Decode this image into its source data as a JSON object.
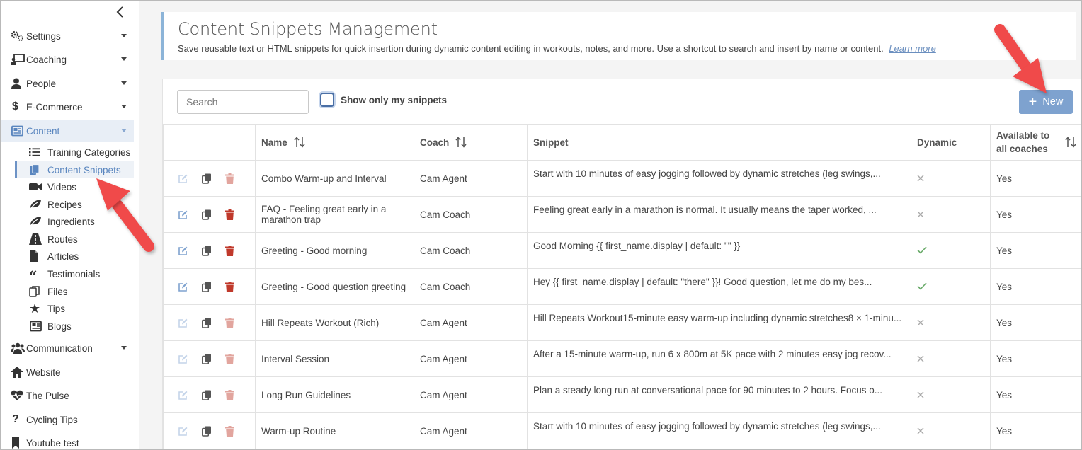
{
  "sidebar": {
    "items": [
      {
        "label": "Settings",
        "icon": "gears-icon"
      },
      {
        "label": "Coaching",
        "icon": "chalkboard-teacher-icon"
      },
      {
        "label": "People",
        "icon": "person-icon"
      },
      {
        "label": "E-Commerce",
        "icon": "dollar-icon"
      },
      {
        "label": "Content",
        "icon": "newspaper-icon"
      },
      {
        "label": "Communication",
        "icon": "users-icon"
      },
      {
        "label": "Website",
        "icon": "home-icon"
      },
      {
        "label": "The Pulse",
        "icon": "heartbeat-icon"
      },
      {
        "label": "Cycling Tips",
        "icon": "question-icon"
      },
      {
        "label": "Youtube test",
        "icon": "bookmark-icon"
      }
    ],
    "content_sub": [
      {
        "label": "Training Categories",
        "icon": "list-icon"
      },
      {
        "label": "Content Snippets",
        "icon": "copy-icon"
      },
      {
        "label": "Videos",
        "icon": "video-camera-icon"
      },
      {
        "label": "Recipes",
        "icon": "leaf-icon"
      },
      {
        "label": "Ingredients",
        "icon": "leaf-icon"
      },
      {
        "label": "Routes",
        "icon": "road-icon"
      },
      {
        "label": "Articles",
        "icon": "file-icon"
      },
      {
        "label": "Testimonials",
        "icon": "quote-icon"
      },
      {
        "label": "Files",
        "icon": "files-icon"
      },
      {
        "label": "Tips",
        "icon": "star-icon"
      },
      {
        "label": "Blogs",
        "icon": "newspaper-icon"
      }
    ]
  },
  "header": {
    "title": "Content Snippets Management",
    "description": "Save reusable text or HTML snippets for quick insertion during dynamic content editing in workouts, notes, and more. Use a shortcut to search and insert by name or content.",
    "learn_more": "Learn more"
  },
  "toolbar": {
    "search_placeholder": "Search",
    "show_mine_label": "Show only my snippets",
    "new_label": "New"
  },
  "table": {
    "columns": [
      "",
      "Name",
      "Coach",
      "Snippet",
      "Dynamic",
      "Available to all coaches"
    ],
    "rows": [
      {
        "name": "Combo Warm-up and Interval",
        "coach": "Cam Agent",
        "snippet": "Start with 10 minutes of easy jogging followed by dynamic stretches (leg swings,...",
        "dynamic": false,
        "available": "Yes",
        "owned": false
      },
      {
        "name": "FAQ - Feeling great early in a marathon trap",
        "coach": "Cam Coach",
        "snippet": "Feeling great early in a marathon is normal. It usually means the taper worked, ...",
        "dynamic": false,
        "available": "Yes",
        "owned": true
      },
      {
        "name": "Greeting - Good morning",
        "coach": "Cam Coach",
        "snippet": "Good Morning {{ first_name.display | default: \"\" }}",
        "dynamic": true,
        "available": "Yes",
        "owned": true
      },
      {
        "name": "Greeting - Good question greeting",
        "coach": "Cam Coach",
        "snippet": "Hey {{ first_name.display | default: \"there\" }}! Good question, let me do my bes...",
        "dynamic": true,
        "available": "Yes",
        "owned": true
      },
      {
        "name": "Hill Repeats Workout (Rich)",
        "coach": "Cam Agent",
        "snippet": "Hill Repeats Workout15-minute easy warm-up including dynamic stretches8 × 1-minu...",
        "dynamic": false,
        "available": "Yes",
        "owned": false
      },
      {
        "name": "Interval Session",
        "coach": "Cam Agent",
        "snippet": "After a 15-minute warm-up, run 6 x 800m at 5K pace with 2 minutes easy jog recov...",
        "dynamic": false,
        "available": "Yes",
        "owned": false
      },
      {
        "name": "Long Run Guidelines",
        "coach": "Cam Agent",
        "snippet": "Plan a steady long run at conversational pace for 90 minutes to 2 hours. Focus o...",
        "dynamic": false,
        "available": "Yes",
        "owned": false
      },
      {
        "name": "Warm-up Routine",
        "coach": "Cam Agent",
        "snippet": "Start with 10 minutes of easy jogging followed by dynamic stretches (leg swings,...",
        "dynamic": false,
        "available": "Yes",
        "owned": false
      }
    ]
  },
  "colors": {
    "accent": "#7ea2cf",
    "link": "#6b8fbf",
    "delete": "#c0392b",
    "check": "#6aab6a",
    "annotation_arrow": "#f04a4a"
  }
}
